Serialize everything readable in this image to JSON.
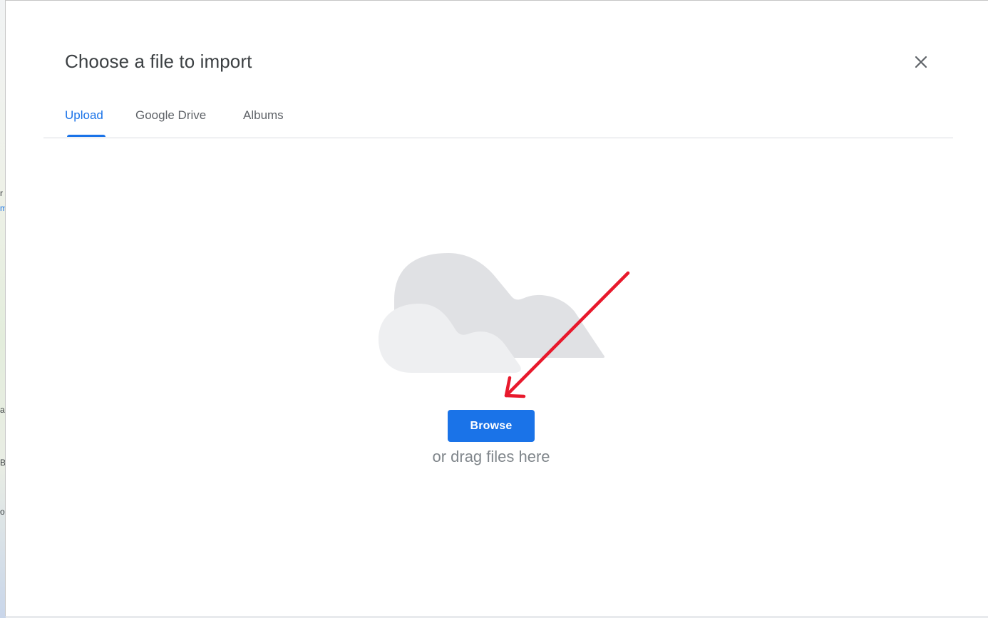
{
  "dialog": {
    "title": "Choose a file to import",
    "close_icon": "close-icon"
  },
  "tabs": [
    {
      "label": "Upload",
      "active": true
    },
    {
      "label": "Google Drive",
      "active": false
    },
    {
      "label": "Albums",
      "active": false
    }
  ],
  "upload": {
    "illustration_icon": "cloud-icon",
    "annotation_icon": "red-arrow-icon",
    "browse_label": "Browse",
    "drag_text": "or drag files here"
  },
  "backdrop": {
    "fragments": [
      "r",
      "m",
      "a",
      "Bc",
      "o"
    ]
  },
  "colors": {
    "accent": "#1a73e8",
    "arrow": "#e8192c",
    "cloud_back": "#e0e1e4",
    "cloud_front": "#eeeff1"
  }
}
